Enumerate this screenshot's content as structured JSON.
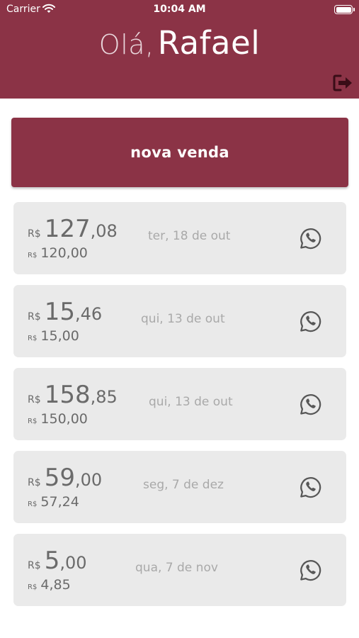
{
  "status_bar": {
    "carrier": "Carrier",
    "time": "10:04 AM"
  },
  "header": {
    "hello": "Olá,",
    "name": "Rafael",
    "logout_icon": "logout-icon",
    "background": "#8b3346"
  },
  "new_sale": {
    "label": "nova venda"
  },
  "currency": "R$",
  "sales": [
    {
      "integer": "127",
      "decimals": ",08",
      "subtotal": "120,00",
      "date": "ter, 18 de out"
    },
    {
      "integer": "15",
      "decimals": ",46",
      "subtotal": "15,00",
      "date": "qui, 13 de out"
    },
    {
      "integer": "158",
      "decimals": ",85",
      "subtotal": "150,00",
      "date": "qui, 13 de out"
    },
    {
      "integer": "59",
      "decimals": ",00",
      "subtotal": "57,24",
      "date": "seg, 7 de dez"
    },
    {
      "integer": "5",
      "decimals": ",00",
      "subtotal": "4,85",
      "date": "qua, 7 de nov"
    }
  ],
  "share_icon": "whatsapp-icon"
}
